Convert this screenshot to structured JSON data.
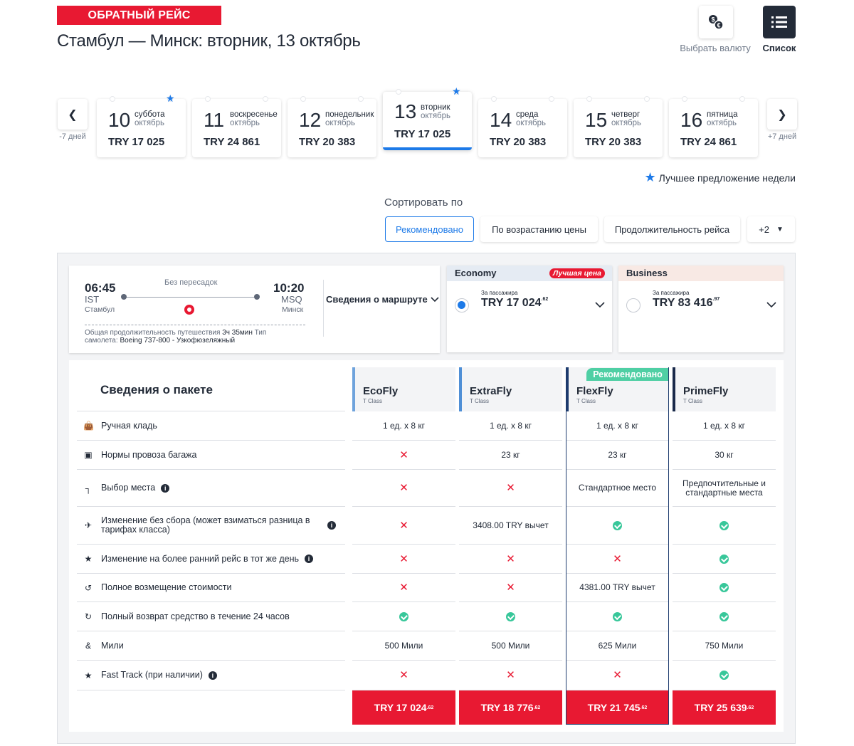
{
  "header": {
    "badge": "ОБРАТНЫЙ РЕЙС",
    "route_title": "Стамбул — Минск: вторник, 13 октябрь",
    "currency_label": "Выбрать валюту",
    "list_label": "Список"
  },
  "dates": {
    "prev_label": "-7 дней",
    "next_label": "+7 дней",
    "days": [
      {
        "day": "10",
        "weekday": "суббота",
        "month": "октябрь",
        "price": "TRY 17 025",
        "best": true,
        "active": false
      },
      {
        "day": "11",
        "weekday": "воскресенье",
        "month": "октябрь",
        "price": "TRY 24 861",
        "best": false,
        "active": false
      },
      {
        "day": "12",
        "weekday": "понедельник",
        "month": "октябрь",
        "price": "TRY 20 383",
        "best": false,
        "active": false
      },
      {
        "day": "13",
        "weekday": "вторник",
        "month": "октябрь",
        "price": "TRY 17 025",
        "best": true,
        "active": true
      },
      {
        "day": "14",
        "weekday": "среда",
        "month": "октябрь",
        "price": "TRY 20 383",
        "best": false,
        "active": false
      },
      {
        "day": "15",
        "weekday": "четверг",
        "month": "октябрь",
        "price": "TRY 20 383",
        "best": false,
        "active": false
      },
      {
        "day": "16",
        "weekday": "пятница",
        "month": "октябрь",
        "price": "TRY 24 861",
        "best": false,
        "active": false
      }
    ],
    "best_week_label": "Лучшее предложение недели"
  },
  "sort": {
    "label": "Сортировать по",
    "options": [
      "Рекомендовано",
      "По возрастанию цены",
      "Продолжительность рейса"
    ],
    "more": "+2"
  },
  "flight": {
    "dep_time": "06:45",
    "dep_code": "IST",
    "dep_city": "Стамбул",
    "arr_time": "10:20",
    "arr_code": "MSQ",
    "arr_city": "Минск",
    "stops": "Без пересадок",
    "total_label": "Общая продолжительность путешествия",
    "duration": "3ч 35мин",
    "aircraft_label": "Тип самолета:",
    "aircraft": "Boeing 737-800 - Узкофюзеляжный",
    "route_link": "Сведения о маршруте"
  },
  "fares": {
    "per_pax": "За пассажира",
    "economy": {
      "name": "Economy",
      "badge": "Лучшая цена",
      "price": "TRY 17 024",
      "cents": ".62"
    },
    "business": {
      "name": "Business",
      "price": "TRY 83 416",
      "cents": ".97"
    }
  },
  "package": {
    "title": "Сведения о пакете",
    "recommended_badge": "Рекомендовано",
    "columns": [
      {
        "name": "EcoFly",
        "class": "T Class",
        "color": "#6fa3dc",
        "price": "TRY 17 024",
        "cents": ".62"
      },
      {
        "name": "ExtraFly",
        "class": "T Class",
        "color": "#4f8fd6",
        "price": "TRY 18 776",
        "cents": ".62"
      },
      {
        "name": "FlexFly",
        "class": "T Class",
        "color": "#1e3c6e",
        "price": "TRY 21 745",
        "cents": ".62"
      },
      {
        "name": "PrimeFly",
        "class": "T Class",
        "color": "#1a2a4a",
        "price": "TRY 25 639",
        "cents": ".62"
      }
    ],
    "rows": [
      {
        "label": "Ручная кладь",
        "icon": "bag-icon",
        "info": false,
        "cells": [
          "1 ед. х 8 кг",
          "1 ед. х 8 кг",
          "1 ед. х 8 кг",
          "1 ед. х 8 кг"
        ]
      },
      {
        "label": "Нормы провоза багажа",
        "icon": "luggage-icon",
        "info": false,
        "cells": [
          "x",
          "23 кг",
          "23 кг",
          "30 кг"
        ]
      },
      {
        "label": "Выбор места",
        "icon": "seat-icon",
        "info": true,
        "cells": [
          "x",
          "x",
          "Стандартное место",
          "Предпочтительные и стандартные места"
        ]
      },
      {
        "label": "Изменение без сбора (может взиматься разница в тарифах класса)",
        "icon": "plane-icon",
        "info": true,
        "cells": [
          "x",
          "3408.00 TRY вычет",
          "ok",
          "ok"
        ]
      },
      {
        "label": "Изменение на более ранний рейс в тот же день",
        "icon": "star-icon",
        "info": true,
        "cells": [
          "x",
          "x",
          "x",
          "ok"
        ]
      },
      {
        "label": "Полное возмещение стоимости",
        "icon": "refund-icon",
        "info": false,
        "cells": [
          "x",
          "x",
          "4381.00 TRY вычет",
          "ok"
        ]
      },
      {
        "label": "Полный возврат средство в течение 24 часов",
        "icon": "clock-refund-icon",
        "info": false,
        "cells": [
          "ok",
          "ok",
          "ok",
          "ok"
        ]
      },
      {
        "label": "Мили",
        "icon": "miles-icon",
        "info": false,
        "cells": [
          "500 Мили",
          "500 Мили",
          "625 Мили",
          "750 Мили"
        ]
      },
      {
        "label": "Fast Track (при наличии)",
        "icon": "star-icon",
        "info": true,
        "cells": [
          "x",
          "x",
          "x",
          "ok"
        ]
      }
    ]
  }
}
